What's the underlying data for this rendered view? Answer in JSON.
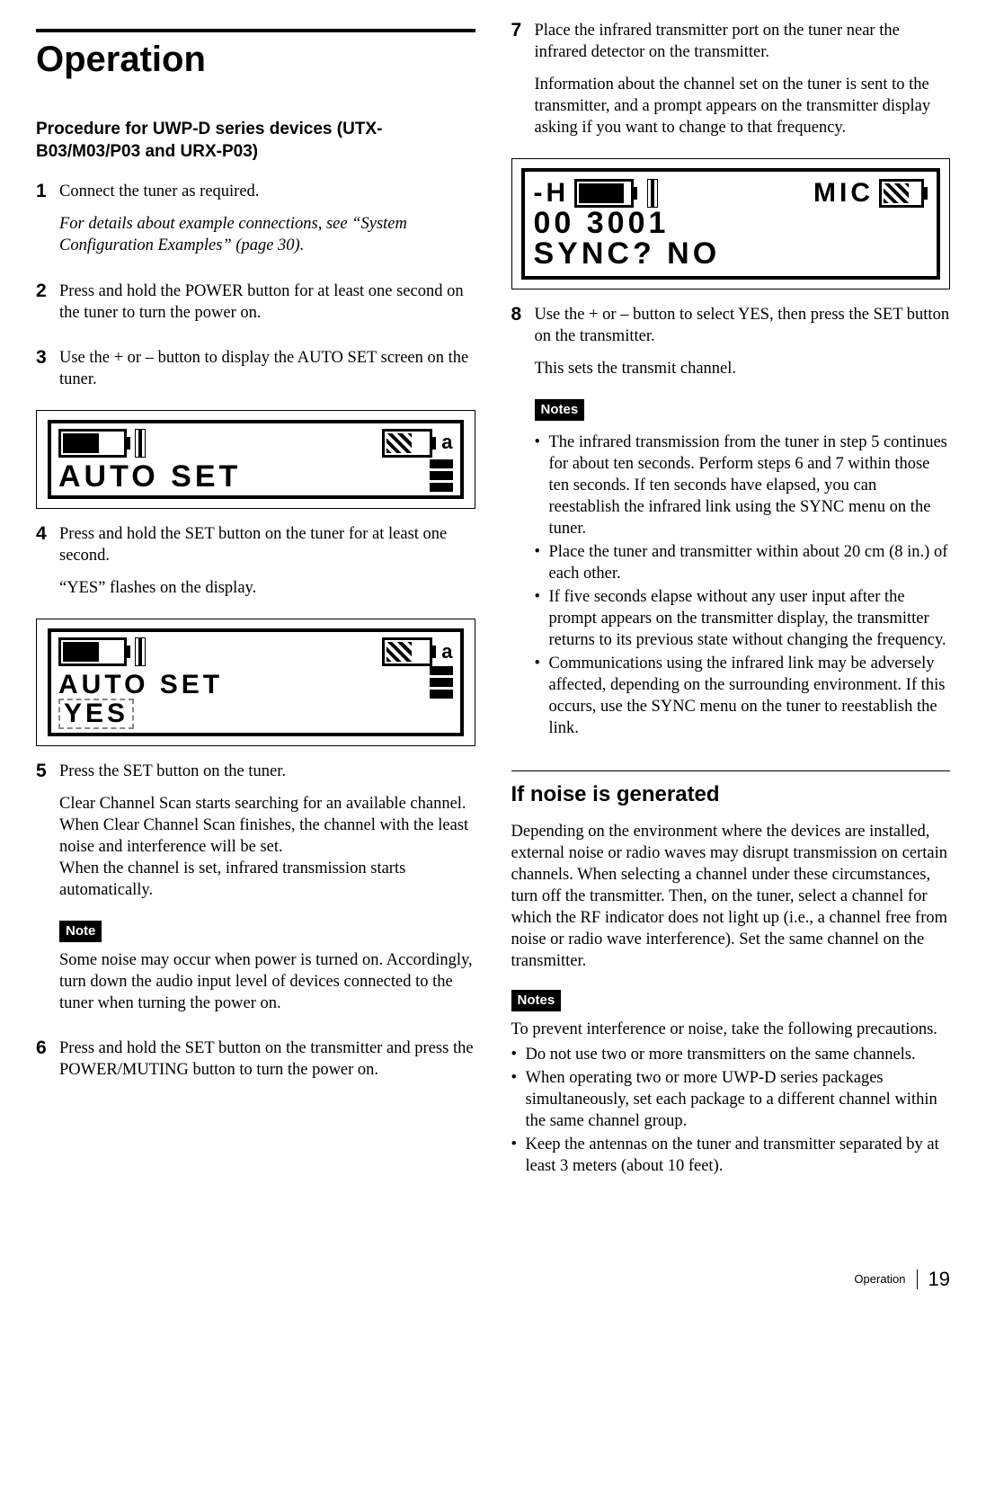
{
  "header": {
    "title": "Operation",
    "procedure_heading": "Procedure for UWP-D series devices (UTX-B03/M03/P03 and URX-P03)"
  },
  "steps": {
    "s1": {
      "num": "1",
      "text": "Connect the tuner as required.",
      "detail_italic": "For details about example connections, see “System Configuration Examples” (page 30)."
    },
    "s2": {
      "num": "2",
      "text": "Press and hold the POWER button for at least one second on the tuner to turn the power on."
    },
    "s3": {
      "num": "3",
      "text": "Use the + or – button to display the AUTO SET screen on the tuner."
    },
    "lcd1": {
      "line1_suffix": "a",
      "line2": "AUTO SET"
    },
    "s4": {
      "num": "4",
      "text": "Press and hold the SET button on the tuner for at least one second.",
      "sub": "“YES” flashes on the display."
    },
    "lcd2": {
      "line1_suffix": "a",
      "line2": "AUTO SET",
      "line3": "YES"
    },
    "s5": {
      "num": "5",
      "text": "Press the SET button on the tuner.",
      "para1": "Clear Channel Scan starts searching for an available channel.",
      "para2": "When Clear Channel Scan finishes, the channel with the least noise and interference will be set.",
      "para3": "When the channel is set, infrared transmission starts automatically.",
      "note_label": "Note",
      "note_text": "Some noise may occur when power is turned on. Accordingly, turn down the audio input level of devices connected to the tuner when turning the power on."
    },
    "s6": {
      "num": "6",
      "text": "Press and hold the SET button on the transmitter and press the POWER/MUTING button to turn the power on."
    },
    "s7": {
      "num": "7",
      "text": "Place the infrared transmitter port on the tuner near the infrared detector on the transmitter.",
      "sub": "Information about the channel set on the tuner is sent to the transmitter, and a prompt appears on the transmitter display asking if you want to change to that frequency."
    },
    "lcd3": {
      "row1_left": "-H",
      "row1_right": "MIC",
      "row2": "00  3001",
      "row3": "SYNC? NO"
    },
    "s8": {
      "num": "8",
      "text": "Use the + or – button to select YES, then press the SET button on the transmitter.",
      "sub": "This sets the transmit channel.",
      "notes_label": "Notes",
      "bullets": [
        "The infrared transmission from the tuner in step 5 continues for about ten seconds. Perform steps 6 and 7 within those ten seconds. If ten seconds have elapsed, you can reestablish the infrared link using the SYNC menu on the tuner.",
        "Place the tuner and transmitter within about 20 cm (8 in.) of each other.",
        "If five seconds elapse without any user input after the prompt appears on the transmitter display, the transmitter returns to its previous state without changing the frequency.",
        "Communications using the infrared link may be adversely affected, depending on the surrounding environment. If this occurs, use the SYNC menu on the tuner to reestablish the link."
      ]
    }
  },
  "noise_section": {
    "heading": "If noise is generated",
    "para": "Depending on the environment where the devices are installed, external noise or radio waves may disrupt transmission on certain channels. When selecting a channel under these circumstances, turn off the transmitter. Then, on the tuner, select a channel for which the RF indicator does not light up (i.e., a channel free from noise or radio wave interference). Set the same channel on the transmitter.",
    "notes_label": "Notes",
    "intro": "To prevent interference or noise, take the following precautions.",
    "bullets": [
      "Do not use two or more transmitters on the same channels.",
      "When operating two or more UWP-D series packages simultaneously, set each package to a different channel within the same channel group.",
      "Keep the antennas on the tuner and transmitter separated by at least 3 meters (about 10 feet)."
    ]
  },
  "footer": {
    "section": "Operation",
    "page": "19"
  }
}
